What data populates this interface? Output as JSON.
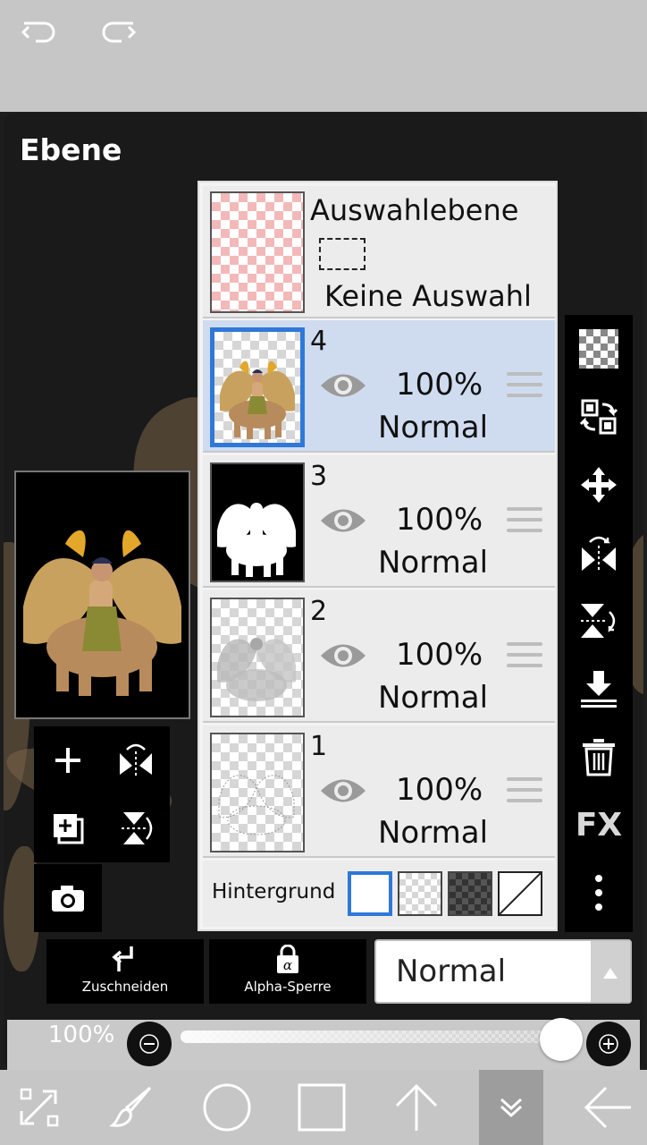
{
  "panel": {
    "title": "Ebene"
  },
  "selection_layer": {
    "title": "Auswahlebene",
    "status": "Keine Auswahl"
  },
  "layers": [
    {
      "number": "4",
      "opacity": "100%",
      "mode": "Normal",
      "selected": true
    },
    {
      "number": "3",
      "opacity": "100%",
      "mode": "Normal",
      "selected": false
    },
    {
      "number": "2",
      "opacity": "100%",
      "mode": "Normal",
      "selected": false
    },
    {
      "number": "1",
      "opacity": "100%",
      "mode": "Normal",
      "selected": false
    }
  ],
  "background_row": {
    "label": "Hintergrund"
  },
  "buttons": {
    "crop": "Zuschneiden",
    "alpha_lock": "Alpha-Sperre",
    "fx": "FX"
  },
  "blend_mode": {
    "value": "Normal"
  },
  "opacity_slider": {
    "label": "100%",
    "value": 1.0
  },
  "colors": {
    "selection_blue": "#2f78d8",
    "selected_row": "#cfdcf0",
    "panel_bg": "#1a1a1a",
    "toolbar_gray": "#c6c6c6"
  },
  "icons": {
    "top": [
      "undo-icon",
      "redo-icon"
    ],
    "right_toolbar": [
      "checker-new-layer-icon",
      "layer-transfer-icon",
      "move-icon",
      "flip-horizontal-icon",
      "flip-vertical-icon",
      "merge-down-icon",
      "trash-icon",
      "fx-icon",
      "more-icon"
    ],
    "pad": [
      "add-layer-icon",
      "flip-layer-h-icon",
      "duplicate-layer-icon",
      "flip-layer-v-icon",
      "camera-icon"
    ],
    "bottom": [
      "transform-tool-icon",
      "brush-tool-icon",
      "ellipse-tool-icon",
      "rect-tool-icon",
      "arrow-up-icon",
      "collapse-icon",
      "back-arrow-icon"
    ]
  }
}
